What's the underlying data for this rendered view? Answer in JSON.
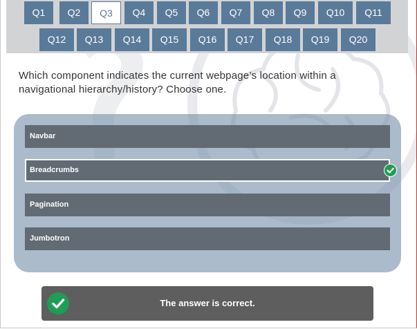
{
  "nav": {
    "row1": [
      "Q1",
      "Q2",
      "Q3",
      "Q4",
      "Q5",
      "Q6",
      "Q7",
      "Q8",
      "Q9",
      "Q10",
      "Q11"
    ],
    "row2": [
      "Q12",
      "Q13",
      "Q14",
      "Q15",
      "Q16",
      "Q17",
      "Q18",
      "Q19",
      "Q20"
    ],
    "active": "Q3"
  },
  "question": {
    "text": "Which component indicates the current webpage’s location within a navigational hierarchy/history? Choose one."
  },
  "options": [
    {
      "label": "Navbar",
      "selected": false
    },
    {
      "label": "Breadcrumbs",
      "selected": true
    },
    {
      "label": "Pagination",
      "selected": false
    },
    {
      "label": "Jumbotron",
      "selected": false
    }
  ],
  "result": {
    "message": "The answer is correct.",
    "icon": "check-circle-icon"
  },
  "colors": {
    "nav_button": "#5a7a99",
    "option_bg": "#626b73",
    "correct_green": "#1f9d55",
    "result_bg": "#5e5e5e"
  }
}
